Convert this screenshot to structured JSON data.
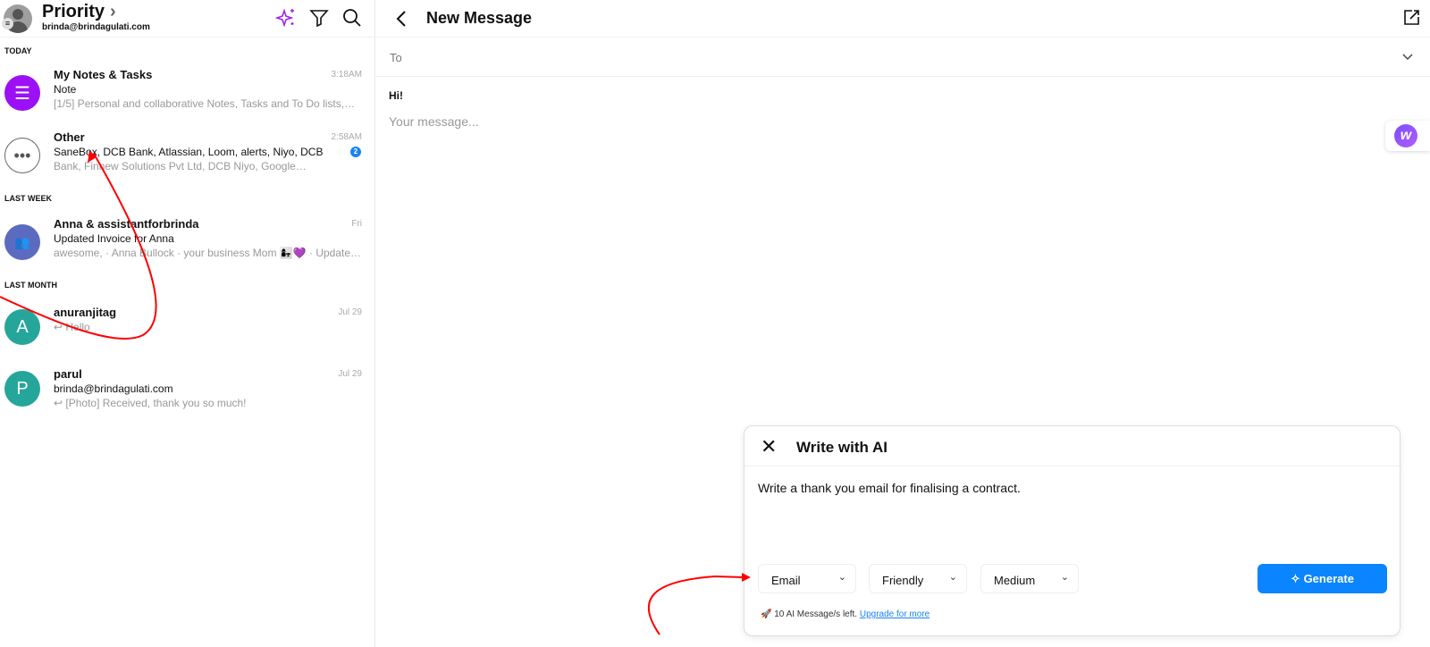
{
  "sidebar": {
    "title": "Priority",
    "account": "brinda@brindagulati.com",
    "sections": {
      "today": "TODAY",
      "last_week": "LAST WEEK",
      "last_month": "LAST MONTH"
    },
    "items": [
      {
        "name": "My Notes & Tasks",
        "line2": "Note",
        "line3": "[1/5] Personal and collaborative Notes, Tasks and To Do lists,…",
        "time": "3:18AM",
        "color": "#9b10f5"
      },
      {
        "name": "Other",
        "line2": "SaneBox, DCB Bank, Atlassian, Loom, alerts, Niyo, DCB",
        "line3": "Bank, Finnew Solutions Pvt Ltd, DCB Niyo, Google…",
        "time": "2:58AM",
        "badge": "2"
      },
      {
        "name": "Anna & assistantforbrinda",
        "line2": "Updated Invoice for Anna",
        "line3": "awesome, · Anna Bullock · your business Mom 👩‍👧💜 · Updates…",
        "time": "Fri",
        "color": "#5c6bc0"
      },
      {
        "name": "anuranjitag",
        "initial": "A",
        "line2": "↩ Hello",
        "time": "Jul 29",
        "color": "#26a69a"
      },
      {
        "name": "parul",
        "initial": "P",
        "line2": "brinda@brindagulati.com",
        "line3": "↩ [Photo] Received, thank you so much!",
        "time": "Jul 29",
        "color": "#26a69a"
      }
    ]
  },
  "compose": {
    "title": "New Message",
    "to_label": "To",
    "greeting": "Hi!",
    "placeholder": "Your message..."
  },
  "ai": {
    "title": "Write with AI",
    "prompt": "Write a thank you email for finalising a contract.",
    "type": "Email",
    "tone": "Friendly",
    "length": "Medium",
    "generate": "Generate",
    "remaining": "10 AI Message/s left.",
    "upgrade": "Upgrade for more"
  }
}
